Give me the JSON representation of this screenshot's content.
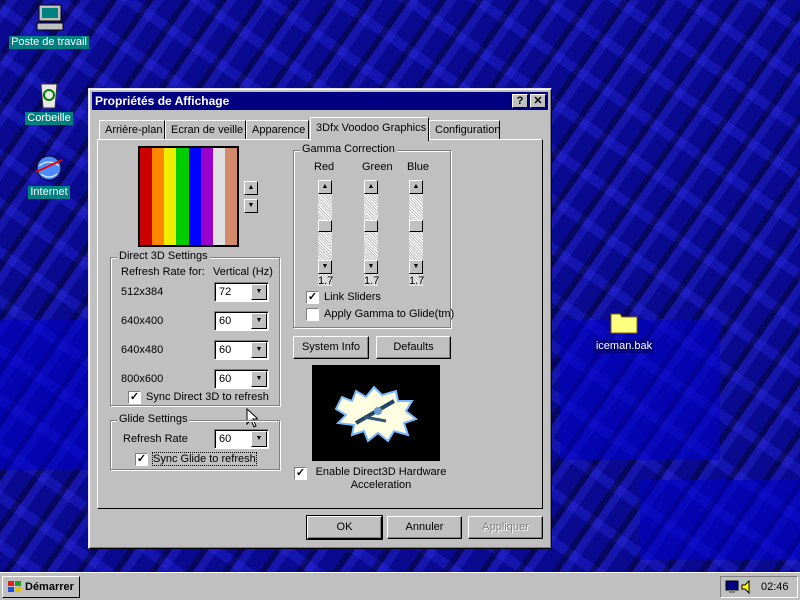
{
  "desktop": {
    "icons": [
      {
        "label": "Poste de travail",
        "icon": "my-computer-icon"
      },
      {
        "label": "Corbeille",
        "icon": "recycle-bin-icon"
      },
      {
        "label": "Internet",
        "icon": "internet-globe-icon"
      },
      {
        "label": "iceman.bak",
        "icon": "folder-icon"
      }
    ]
  },
  "window": {
    "title": "Propriétés de Affichage",
    "help_btn": "?",
    "close_btn": "✕",
    "tabs": [
      "Arrière-plan",
      "Ecran de veille",
      "Apparence",
      "3Dfx Voodoo Graphics",
      "Configuration"
    ],
    "active_tab": "3Dfx Voodoo Graphics",
    "color_bars": [
      "#cc0000",
      "#ff8800",
      "#eeee00",
      "#00cc00",
      "#0000ff",
      "#9900cc",
      "#e0e0e0",
      "#d48a6a"
    ],
    "spin_up": "▲",
    "spin_down": "▼",
    "direct3d": {
      "title": "Direct 3D Settings",
      "refresh_label": "Refresh Rate for:",
      "vertical_label": "Vertical (Hz)",
      "rows": [
        {
          "res": "512x384",
          "value": "72"
        },
        {
          "res": "640x400",
          "value": "60"
        },
        {
          "res": "640x480",
          "value": "60"
        },
        {
          "res": "800x600",
          "value": "60"
        }
      ],
      "sync_label": "Sync Direct 3D to refresh",
      "sync_checked": "✓"
    },
    "glide": {
      "title": "Glide Settings",
      "refresh_label": "Refresh Rate",
      "value": "60",
      "sync_label": "Sync Glide to refresh",
      "sync_checked": "✓"
    },
    "gamma": {
      "title": "Gamma Correction",
      "channels": [
        {
          "name": "Red",
          "value": "1.7"
        },
        {
          "name": "Green",
          "value": "1.7"
        },
        {
          "name": "Blue",
          "value": "1.7"
        }
      ],
      "link_label": "Link Sliders",
      "link_checked": "✓",
      "apply_label": "Apply Gamma to Glide(tm)",
      "apply_checked": ""
    },
    "system_info_btn": "System Info",
    "defaults_btn": "Defaults",
    "enable_d3d_label": "Enable Direct3D Hardware Acceleration",
    "enable_d3d_checked": "✓",
    "ok_btn": "OK",
    "cancel_btn": "Annuler",
    "apply_btn": "Appliquer"
  },
  "taskbar": {
    "start_label": "Démarrer",
    "clock": "02:46"
  }
}
